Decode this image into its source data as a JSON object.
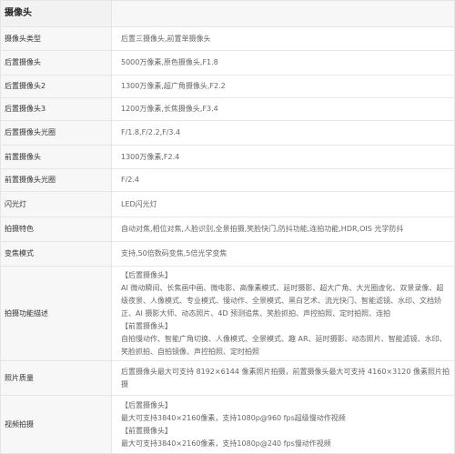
{
  "section_title": "摄像头",
  "rows": [
    {
      "key": "摄像头类型",
      "value": "后置三摄像头,前置单摄像头"
    },
    {
      "key": "后置摄像头",
      "value": "5000万像素,原色摄像头,F1.8"
    },
    {
      "key": "后置摄像头2",
      "value": "1300万像素,超广角摄像头,F2.2"
    },
    {
      "key": "后置摄像头3",
      "value": "1200万像素,长焦摄像头,F3.4"
    },
    {
      "key": "后置摄像头光圈",
      "value": "F/1.8,F/2.2,F/3.4"
    },
    {
      "key": "前置摄像头",
      "value": "1300万像素,F2.4"
    },
    {
      "key": "前置摄像头光圈",
      "value": "F/2.4"
    },
    {
      "key": "闪光灯",
      "value": "LED闪光灯"
    },
    {
      "key": "拍摄特色",
      "value": "自动对焦,相位对焦,人脸识别,全景拍摄,笑脸快门,防抖功能,连拍功能,HDR,OIS 光学防抖"
    },
    {
      "key": "变焦模式",
      "value": "支持,50倍数码变焦,5倍光学变焦"
    }
  ],
  "features": {
    "key": "拍摄功能描述",
    "rear_title": "【后置摄像头】",
    "rear_text": "AI 微动瞬间、长焦画中画、微电影、高像素模式、延时摄影、超大广角、大光圈虚化、双景录像、超级夜景、人像模式、专业模式、慢动作、全景模式、黑白艺术、流光快门、智能滤镜、水印、文档矫正、AI 摄影大师、动态照片、4D 预测追焦、笑脸抓拍、声控拍照、定时拍照、连拍",
    "front_title": "【前置摄像头】",
    "front_text": "自拍慢动作、智能广角切换、人像模式、全景模式、趣 AR、延时摄影、动态照片、智能滤镜、水印、笑脸抓拍、自拍镜像、声控拍照、定时拍照"
  },
  "photo_quality": {
    "key": "照片质量",
    "value": "后置摄像头最大可支持 8192×6144 像素照片拍摄，前置摄像头最大可支持 4160×3120 像素照片拍摄"
  },
  "video": {
    "key": "视频拍摄",
    "rear_title": "【后置摄像头】",
    "rear_text": "最大可支持3840×2160像素，支持1080p@960 fps超级慢动作视频",
    "front_title": "【前置摄像头】",
    "front_text": "最大可支持3840×2160像素，支持1080p@240 fps慢动作视频"
  }
}
